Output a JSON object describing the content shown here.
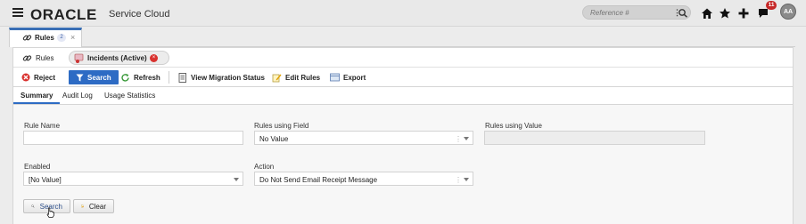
{
  "header": {
    "brand": "ORACLE",
    "product": "Service Cloud",
    "reference_placeholder": "Reference #",
    "notification_count": "11",
    "avatar_initials": "AA"
  },
  "workspace_tab": {
    "label": "Rules",
    "count": "2",
    "close": "×"
  },
  "sub_tabs": [
    {
      "label": "Rules"
    },
    {
      "label": "Incidents (Active)",
      "close": "×"
    }
  ],
  "toolbar": {
    "reject": "Reject",
    "search": "Search",
    "refresh": "Refresh",
    "view_migration_status": "View Migration Status",
    "edit_rules": "Edit Rules",
    "export": "Export"
  },
  "view_tabs": [
    "Summary",
    "Audit Log",
    "Usage Statistics"
  ],
  "form": {
    "rule_name_label": "Rule Name",
    "rule_name_value": "",
    "rules_using_field_label": "Rules using Field",
    "rules_using_field_value": "No Value",
    "rules_using_value_label": "Rules using Value",
    "enabled_label": "Enabled",
    "enabled_value": "[No Value]",
    "action_label": "Action",
    "action_value": "Do Not Send Email Receipt Message",
    "search_button": "Search",
    "clear_button": "Clear"
  },
  "colors": {
    "accent": "#2d6bc4",
    "danger": "#d9322f",
    "badge": "#c62828"
  }
}
